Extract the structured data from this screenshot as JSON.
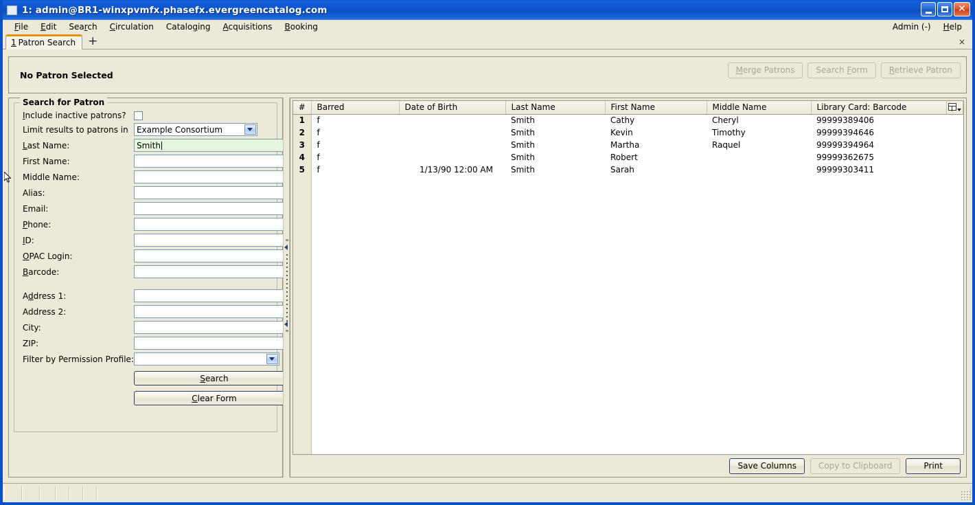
{
  "window": {
    "title": "1: admin@BR1-winxpvmfx.phasefx.evergreencatalog.com",
    "minimize_label": "",
    "maximize_label": "",
    "close_label": "✕"
  },
  "menubar": {
    "items": [
      {
        "label": "File",
        "accel": "F"
      },
      {
        "label": "Edit",
        "accel": "E"
      },
      {
        "label": "Search",
        "accel": "r"
      },
      {
        "label": "Circulation",
        "accel": "C"
      },
      {
        "label": "Cataloging",
        "accel": "g"
      },
      {
        "label": "Acquisitions",
        "accel": "A"
      },
      {
        "label": "Booking",
        "accel": "B"
      }
    ],
    "admin_label": "Admin (-)",
    "help_label": "Help"
  },
  "tabbar": {
    "tabs": [
      {
        "number": "1",
        "label": "Patron Search"
      }
    ],
    "add_label": "+",
    "close_label": "×"
  },
  "patron_header": {
    "status_text": "No Patron Selected",
    "buttons": [
      {
        "label": "Merge Patrons",
        "accel": "M",
        "disabled": true
      },
      {
        "label": "Search Form",
        "accel": "F",
        "disabled": true
      },
      {
        "label": "Retrieve Patron",
        "accel": "R",
        "disabled": true
      }
    ]
  },
  "search_form": {
    "legend": "Search for Patron",
    "fields": [
      {
        "label": "Include inactive patrons?",
        "accel": "I",
        "type": "checkbox",
        "checked": false
      },
      {
        "label": "Limit results to patrons in",
        "accel": "",
        "type": "select",
        "value": "Example Consortium"
      },
      {
        "label": "Last Name:",
        "accel": "L",
        "type": "text",
        "value": "Smith",
        "active": true
      },
      {
        "label": "First Name:",
        "accel": "",
        "type": "text",
        "value": ""
      },
      {
        "label": "Middle Name:",
        "accel": "",
        "type": "text",
        "value": ""
      },
      {
        "label": "Alias:",
        "accel": "",
        "type": "text",
        "value": ""
      },
      {
        "label": "Email:",
        "accel": "",
        "type": "text",
        "value": ""
      },
      {
        "label": "Phone:",
        "accel": "P",
        "type": "text",
        "value": ""
      },
      {
        "label": "ID:",
        "accel": "I",
        "type": "text",
        "value": ""
      },
      {
        "label": "OPAC Login:",
        "accel": "O",
        "type": "text",
        "value": ""
      },
      {
        "label": "Barcode:",
        "accel": "B",
        "type": "text",
        "value": ""
      },
      {
        "label": "Address 1:",
        "accel": "d",
        "type": "text",
        "value": "",
        "gap_before": true
      },
      {
        "label": "Address 2:",
        "accel": "",
        "type": "text",
        "value": ""
      },
      {
        "label": "City:",
        "accel": "",
        "type": "text",
        "value": ""
      },
      {
        "label": "ZIP:",
        "accel": "",
        "type": "text",
        "value": ""
      },
      {
        "label": "Filter by Permission Profile:",
        "accel": "",
        "type": "select",
        "value": ""
      }
    ],
    "search_button": {
      "label": "Search",
      "accel": "S"
    },
    "clear_button": {
      "label": "Clear Form",
      "accel": "C"
    }
  },
  "results": {
    "columns": [
      "#",
      "Barred",
      "Date of Birth",
      "Last Name",
      "First Name",
      "Middle Name",
      "Library Card: Barcode"
    ],
    "column_picker_icon": "column-picker-icon",
    "rows": [
      {
        "num": "1",
        "barred": "f",
        "dob": "",
        "last": "Smith",
        "first": "Cathy",
        "middle": "Cheryl",
        "card": "99999389406"
      },
      {
        "num": "2",
        "barred": "f",
        "dob": "",
        "last": "Smith",
        "first": "Kevin",
        "middle": "Timothy",
        "card": "99999394646"
      },
      {
        "num": "3",
        "barred": "f",
        "dob": "",
        "last": "Smith",
        "first": "Martha",
        "middle": "Raquel",
        "card": "99999394964"
      },
      {
        "num": "4",
        "barred": "f",
        "dob": "",
        "last": "Smith",
        "first": "Robert",
        "middle": "",
        "card": "99999362675"
      },
      {
        "num": "5",
        "barred": "f",
        "dob": "1/13/90 12:00 AM",
        "last": "Smith",
        "first": "Sarah",
        "middle": "",
        "card": "99999303411"
      }
    ],
    "footer_buttons": [
      {
        "label": "Save Columns",
        "disabled": false
      },
      {
        "label": "Copy to Clipboard",
        "disabled": true
      },
      {
        "label": "Print",
        "disabled": false
      }
    ]
  },
  "statusbar": {
    "segments": [
      "",
      "",
      "",
      "",
      "",
      "",
      ""
    ]
  },
  "colors": {
    "titlebar_blue": "#0d55cc",
    "window_border": "#0a50c8",
    "chrome_beige": "#ece9d8",
    "active_field_green": "#e4f7dd",
    "tab_accent_orange": "#e8930c",
    "field_border_blue": "#7b9ab5"
  }
}
